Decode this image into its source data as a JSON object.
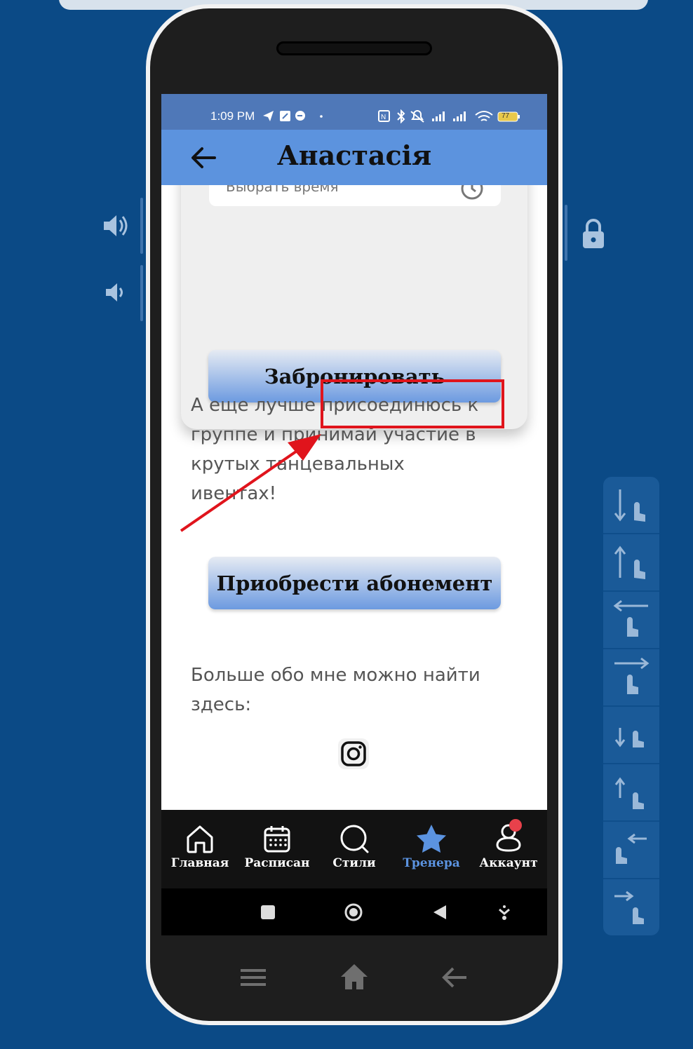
{
  "status_bar": {
    "time": "1:09 PM",
    "battery": "77"
  },
  "app_bar": {
    "title": "Анастасія"
  },
  "booking_card": {
    "time_placeholder": "Выбрать время",
    "book_button": "Забронировать"
  },
  "promo": {
    "lines": [
      "А еще лучше присоединюсь к",
      "группе и принимай участие в",
      "крутых танцевальных",
      "ивентах!"
    ],
    "subscribe_button": "Приобрести абонемент"
  },
  "more_info": {
    "lines": [
      "Больше обо мне можно найти",
      "здесь:"
    ]
  },
  "bottom_nav": {
    "items": [
      {
        "label": "Главная",
        "icon": "home-icon"
      },
      {
        "label": "Расписан",
        "icon": "calendar-icon"
      },
      {
        "label": "Стили",
        "icon": "search-icon"
      },
      {
        "label": "Тренера",
        "icon": "star-icon"
      },
      {
        "label": "Аккаунт",
        "icon": "account-icon"
      }
    ],
    "active_index": 3,
    "active_color": "#5b93e0"
  },
  "colors": {
    "app_bar": "#5c93de",
    "status_bar": "#4f78b8",
    "background": "#0b4a86",
    "annotation": "#e0141c"
  }
}
